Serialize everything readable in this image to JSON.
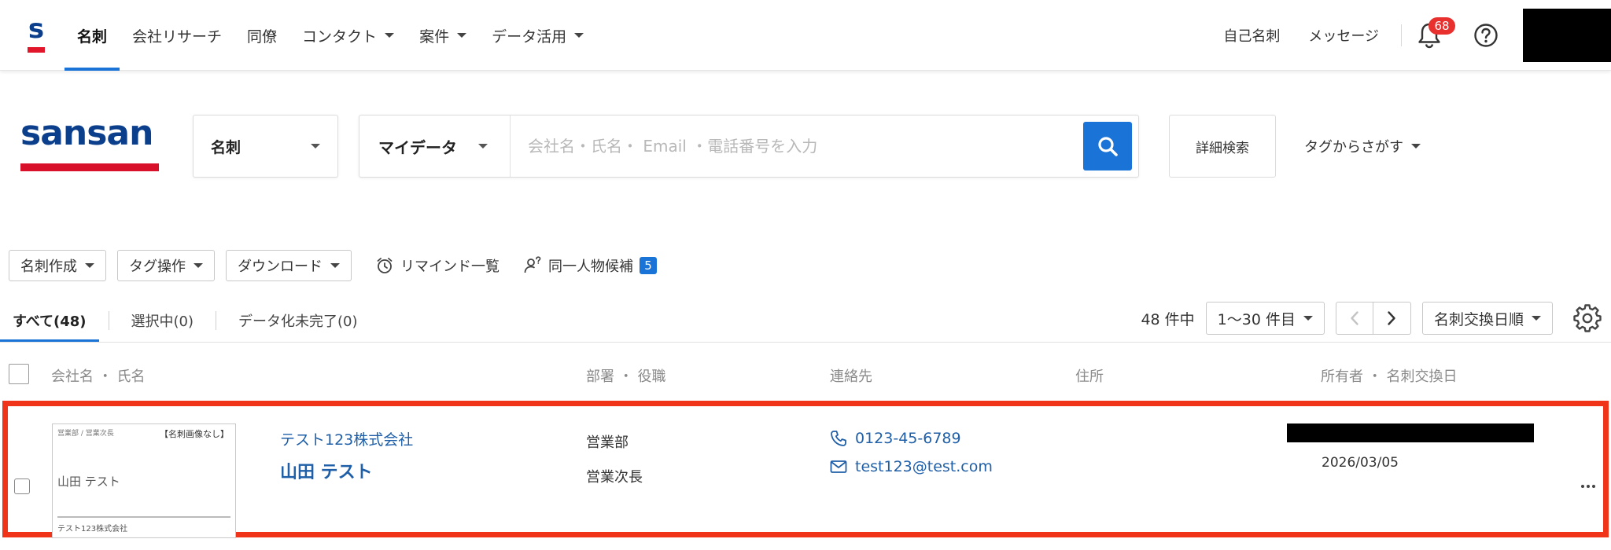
{
  "nav": {
    "brand_letter": "s",
    "items": [
      {
        "label": "名刺",
        "active": true,
        "dropdown": false
      },
      {
        "label": "会社リサーチ",
        "active": false,
        "dropdown": false
      },
      {
        "label": "同僚",
        "active": false,
        "dropdown": false
      },
      {
        "label": "コンタクト",
        "active": false,
        "dropdown": true
      },
      {
        "label": "案件",
        "active": false,
        "dropdown": true
      },
      {
        "label": "データ活用",
        "active": false,
        "dropdown": true
      }
    ],
    "my_card": "自己名刺",
    "messages": "メッセージ",
    "notification_count": "68",
    "icons": {
      "notification": "bell-icon",
      "help": "help-icon"
    }
  },
  "search": {
    "logo_text": "sansan",
    "card_type": "名刺",
    "scope": "マイデータ",
    "placeholder": "会社名・氏名・ Email ・電話番号を入力",
    "value": "",
    "advanced_label": "詳細検索",
    "tag_search_label": "タグからさがす"
  },
  "toolbar": {
    "create_label": "名刺作成",
    "tag_ops_label": "タグ操作",
    "download_label": "ダウンロード",
    "reminder_label": "リマインド一覧",
    "duplicates_label": "同一人物候補",
    "duplicates_count": "5"
  },
  "tabs": {
    "all": "すべて(48)",
    "selected": "選択中(0)",
    "pending": "データ化未完了(0)"
  },
  "pager": {
    "total": "48 件中",
    "range": "1〜30 件目",
    "sort": "名刺交換日順"
  },
  "table": {
    "headers": {
      "name": "会社名 ・ 氏名",
      "dept": "部署 ・ 役職",
      "contact": "連絡先",
      "address": "住所",
      "owner": "所有者 ・ 名刺交換日"
    },
    "rows": [
      {
        "thumb": {
          "dept_title": "営業部 / 営業次長",
          "no_image": "【名刺画像なし】",
          "name": "山田 テスト",
          "company": "テスト123株式会社"
        },
        "company": "テスト123株式会社",
        "person": "山田 テスト",
        "department": "営業部",
        "title": "営業次長",
        "phone": "0123-45-6789",
        "email": "test123@test.com",
        "address": "",
        "exchange_date": "2026/03/05"
      }
    ]
  },
  "colors": {
    "accent": "#1a73d6",
    "brand_navy": "#0b3f8c",
    "brand_red": "#d8102a",
    "link": "#1f5fa8",
    "highlight_border": "#f03419",
    "badge": "#e8312f"
  }
}
